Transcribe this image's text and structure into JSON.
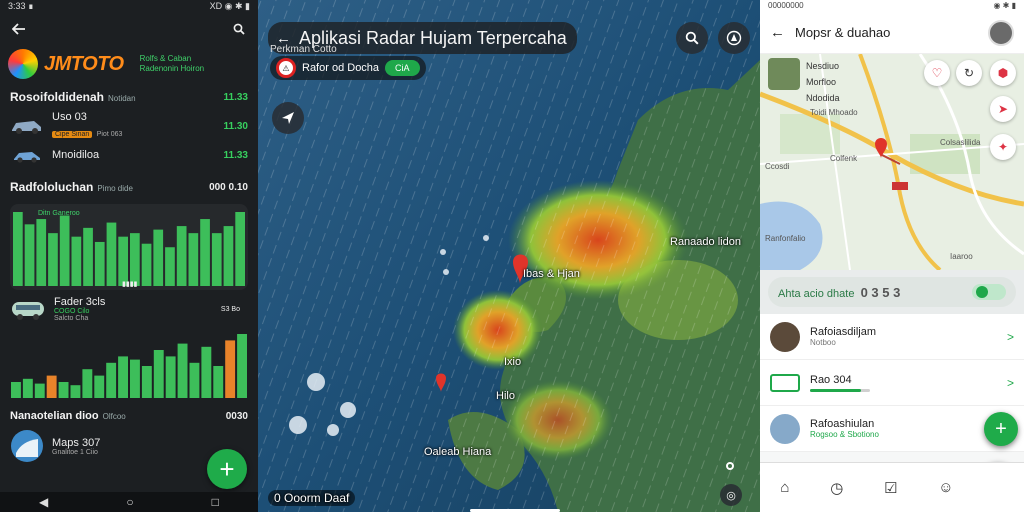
{
  "left": {
    "status": {
      "left": "3:33 ∎",
      "right": "XD ◉ ✱ ▮"
    },
    "brand": {
      "name": "JMTOTO",
      "tag_line1": "Rolfs & Caban",
      "tag_line2": "Radenonin Hoiron"
    },
    "section1": {
      "title": "Rosoifoldidenah",
      "sub": "Notidan",
      "value": "11.33"
    },
    "items": [
      {
        "title": "Uso 03",
        "badge": "Cipe Sinan",
        "meta": "Piot 063",
        "value": "11.30"
      },
      {
        "title": "Mnoidiloa",
        "badge": "",
        "meta": "",
        "value": "11.33"
      }
    ],
    "section2": {
      "title": "Radfololuchan",
      "sub": "Pimo dide",
      "value": "000 0.10"
    },
    "chart1": {
      "dots": "▮▮▮▮",
      "legend": "Ditn Ganeroo"
    },
    "card2": {
      "title": "Fader 3cls",
      "meta1": "COGO Cilo",
      "meta2": "Salcto Cha",
      "tag": "S3 Bo"
    },
    "section3": {
      "title": "Nanaotelian dioo",
      "sub": "Olfcoo",
      "value": "0030"
    },
    "bottom_item": {
      "title": "Maps 307",
      "meta": "Gnalitoe 1 Ciio"
    },
    "fab_label": "+",
    "nav": [
      "◀",
      "○",
      "□"
    ]
  },
  "middle": {
    "status": "◉ ✱ ▮",
    "title": "Aplikasi Radar Hujam Terpercaha",
    "subtitle": "Perkman Cotto",
    "location": "Rafor od  Docha",
    "location_badge": "CiA",
    "labels": {
      "pin": "Ibas & Hjan",
      "east": "Ranaado lidon",
      "inland": "Ixio",
      "inland2": "Hilo",
      "south": "Oaleab Hiana",
      "bottom": "0 Ooorm Daaf"
    }
  },
  "right": {
    "status": {
      "left": "00000000",
      "right": "◉ ✱ ▮"
    },
    "title": "Mopsr & duahao",
    "info": {
      "line1": "Nesdiuo",
      "line2": "Morfloo",
      "line3": "Ndodida"
    },
    "map_labels": {
      "a": "Toidi Mhoado",
      "b": "Colsaslilida",
      "c": "Colfenk",
      "d": "Ccosdi",
      "e": "Ranfonfalio",
      "f": "Iaaroo"
    },
    "bar": {
      "text": "Ahta  acio  dhate",
      "value": "0 3 5 3"
    },
    "list": [
      {
        "title": "Rafoiasdiljam",
        "meta": "Notboo",
        "progress": 0
      },
      {
        "title": "Rao 304",
        "meta": "",
        "progress": 0.85
      },
      {
        "title": "Rafoashiulan",
        "meta": "Rogsoo & Sbotiono",
        "progress": 0
      }
    ],
    "fab_label": "+"
  },
  "chart_data": [
    {
      "type": "bar",
      "values": [
        42,
        35,
        38,
        30,
        40,
        28,
        33,
        25,
        36,
        28,
        30,
        24,
        32,
        22,
        34,
        30,
        38,
        30,
        34,
        42
      ]
    },
    {
      "type": "bar",
      "values": [
        10,
        12,
        9,
        14,
        10,
        8,
        18,
        14,
        22,
        26,
        24,
        20,
        30,
        26,
        34,
        22,
        32,
        20,
        36,
        40
      ]
    }
  ],
  "colors": {
    "accent_green": "#1fab4a",
    "chart_green": "#3dbe5a",
    "chart_orange": "#e8832a",
    "brand_orange": "#ff8c1a"
  },
  "icons": {
    "back": "arrow-left-icon",
    "search": "search-icon",
    "compass": "compass-icon",
    "navigation": "navigation-arrow-icon",
    "home": "home-icon",
    "clock": "clock-icon",
    "list": "checklist-icon",
    "bag": "basket-icon"
  }
}
